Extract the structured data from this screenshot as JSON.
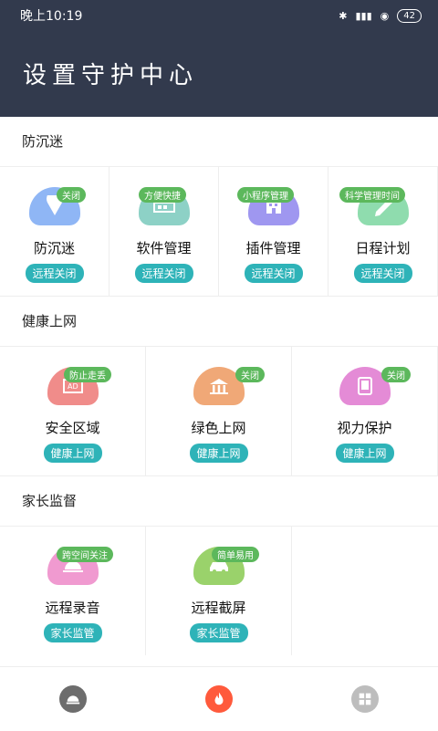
{
  "status": {
    "time": "晚上10:19",
    "battery": "42"
  },
  "header": {
    "title": "设置守护中心"
  },
  "sections": [
    {
      "title": "防沉迷",
      "items": [
        {
          "label": "防沉迷",
          "badge": "关闭",
          "tag": "远程关闭",
          "color": "#8fb6f5"
        },
        {
          "label": "软件管理",
          "badge": "方便快捷",
          "tag": "远程关闭",
          "color": "#8dd1c6"
        },
        {
          "label": "插件管理",
          "badge": "小程序管理",
          "tag": "远程关闭",
          "color": "#9f97f0"
        },
        {
          "label": "日程计划",
          "badge": "科学管理时间",
          "tag": "远程关闭",
          "color": "#8fdcae"
        }
      ]
    },
    {
      "title": "健康上网",
      "items": [
        {
          "label": "安全区域",
          "badge": "防止走丢",
          "tag": "健康上网",
          "color": "#f08c8a"
        },
        {
          "label": "绿色上网",
          "badge": "关闭",
          "tag": "健康上网",
          "color": "#f0a877"
        },
        {
          "label": "视力保护",
          "badge": "关闭",
          "tag": "健康上网",
          "color": "#e48bd6"
        }
      ]
    },
    {
      "title": "家长监督",
      "items": [
        {
          "label": "远程录音",
          "badge": "跨空间关注",
          "tag": "家长监管",
          "color": "#f09ad0"
        },
        {
          "label": "远程截屏",
          "badge": "简单易用",
          "tag": "家长监管",
          "color": "#9ad26b"
        }
      ]
    }
  ],
  "nav": {
    "icons": [
      "home-icon",
      "fire-icon",
      "apps-icon"
    ],
    "active_color": "#ff5a3c"
  }
}
